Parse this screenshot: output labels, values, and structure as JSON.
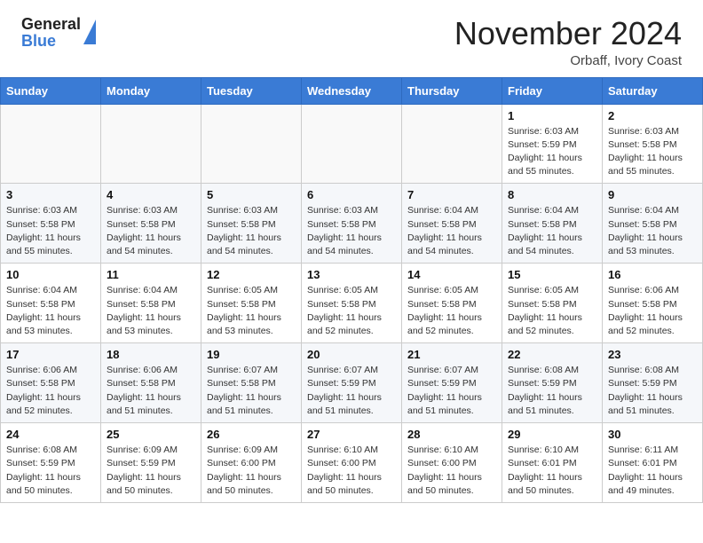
{
  "header": {
    "logo_general": "General",
    "logo_blue": "Blue",
    "month_title": "November 2024",
    "location": "Orbaff, Ivory Coast"
  },
  "days_of_week": [
    "Sunday",
    "Monday",
    "Tuesday",
    "Wednesday",
    "Thursday",
    "Friday",
    "Saturday"
  ],
  "weeks": [
    [
      {
        "day": "",
        "info": ""
      },
      {
        "day": "",
        "info": ""
      },
      {
        "day": "",
        "info": ""
      },
      {
        "day": "",
        "info": ""
      },
      {
        "day": "",
        "info": ""
      },
      {
        "day": "1",
        "info": "Sunrise: 6:03 AM\nSunset: 5:59 PM\nDaylight: 11 hours\nand 55 minutes."
      },
      {
        "day": "2",
        "info": "Sunrise: 6:03 AM\nSunset: 5:58 PM\nDaylight: 11 hours\nand 55 minutes."
      }
    ],
    [
      {
        "day": "3",
        "info": "Sunrise: 6:03 AM\nSunset: 5:58 PM\nDaylight: 11 hours\nand 55 minutes."
      },
      {
        "day": "4",
        "info": "Sunrise: 6:03 AM\nSunset: 5:58 PM\nDaylight: 11 hours\nand 54 minutes."
      },
      {
        "day": "5",
        "info": "Sunrise: 6:03 AM\nSunset: 5:58 PM\nDaylight: 11 hours\nand 54 minutes."
      },
      {
        "day": "6",
        "info": "Sunrise: 6:03 AM\nSunset: 5:58 PM\nDaylight: 11 hours\nand 54 minutes."
      },
      {
        "day": "7",
        "info": "Sunrise: 6:04 AM\nSunset: 5:58 PM\nDaylight: 11 hours\nand 54 minutes."
      },
      {
        "day": "8",
        "info": "Sunrise: 6:04 AM\nSunset: 5:58 PM\nDaylight: 11 hours\nand 54 minutes."
      },
      {
        "day": "9",
        "info": "Sunrise: 6:04 AM\nSunset: 5:58 PM\nDaylight: 11 hours\nand 53 minutes."
      }
    ],
    [
      {
        "day": "10",
        "info": "Sunrise: 6:04 AM\nSunset: 5:58 PM\nDaylight: 11 hours\nand 53 minutes."
      },
      {
        "day": "11",
        "info": "Sunrise: 6:04 AM\nSunset: 5:58 PM\nDaylight: 11 hours\nand 53 minutes."
      },
      {
        "day": "12",
        "info": "Sunrise: 6:05 AM\nSunset: 5:58 PM\nDaylight: 11 hours\nand 53 minutes."
      },
      {
        "day": "13",
        "info": "Sunrise: 6:05 AM\nSunset: 5:58 PM\nDaylight: 11 hours\nand 52 minutes."
      },
      {
        "day": "14",
        "info": "Sunrise: 6:05 AM\nSunset: 5:58 PM\nDaylight: 11 hours\nand 52 minutes."
      },
      {
        "day": "15",
        "info": "Sunrise: 6:05 AM\nSunset: 5:58 PM\nDaylight: 11 hours\nand 52 minutes."
      },
      {
        "day": "16",
        "info": "Sunrise: 6:06 AM\nSunset: 5:58 PM\nDaylight: 11 hours\nand 52 minutes."
      }
    ],
    [
      {
        "day": "17",
        "info": "Sunrise: 6:06 AM\nSunset: 5:58 PM\nDaylight: 11 hours\nand 52 minutes."
      },
      {
        "day": "18",
        "info": "Sunrise: 6:06 AM\nSunset: 5:58 PM\nDaylight: 11 hours\nand 51 minutes."
      },
      {
        "day": "19",
        "info": "Sunrise: 6:07 AM\nSunset: 5:58 PM\nDaylight: 11 hours\nand 51 minutes."
      },
      {
        "day": "20",
        "info": "Sunrise: 6:07 AM\nSunset: 5:59 PM\nDaylight: 11 hours\nand 51 minutes."
      },
      {
        "day": "21",
        "info": "Sunrise: 6:07 AM\nSunset: 5:59 PM\nDaylight: 11 hours\nand 51 minutes."
      },
      {
        "day": "22",
        "info": "Sunrise: 6:08 AM\nSunset: 5:59 PM\nDaylight: 11 hours\nand 51 minutes."
      },
      {
        "day": "23",
        "info": "Sunrise: 6:08 AM\nSunset: 5:59 PM\nDaylight: 11 hours\nand 51 minutes."
      }
    ],
    [
      {
        "day": "24",
        "info": "Sunrise: 6:08 AM\nSunset: 5:59 PM\nDaylight: 11 hours\nand 50 minutes."
      },
      {
        "day": "25",
        "info": "Sunrise: 6:09 AM\nSunset: 5:59 PM\nDaylight: 11 hours\nand 50 minutes."
      },
      {
        "day": "26",
        "info": "Sunrise: 6:09 AM\nSunset: 6:00 PM\nDaylight: 11 hours\nand 50 minutes."
      },
      {
        "day": "27",
        "info": "Sunrise: 6:10 AM\nSunset: 6:00 PM\nDaylight: 11 hours\nand 50 minutes."
      },
      {
        "day": "28",
        "info": "Sunrise: 6:10 AM\nSunset: 6:00 PM\nDaylight: 11 hours\nand 50 minutes."
      },
      {
        "day": "29",
        "info": "Sunrise: 6:10 AM\nSunset: 6:01 PM\nDaylight: 11 hours\nand 50 minutes."
      },
      {
        "day": "30",
        "info": "Sunrise: 6:11 AM\nSunset: 6:01 PM\nDaylight: 11 hours\nand 49 minutes."
      }
    ]
  ]
}
